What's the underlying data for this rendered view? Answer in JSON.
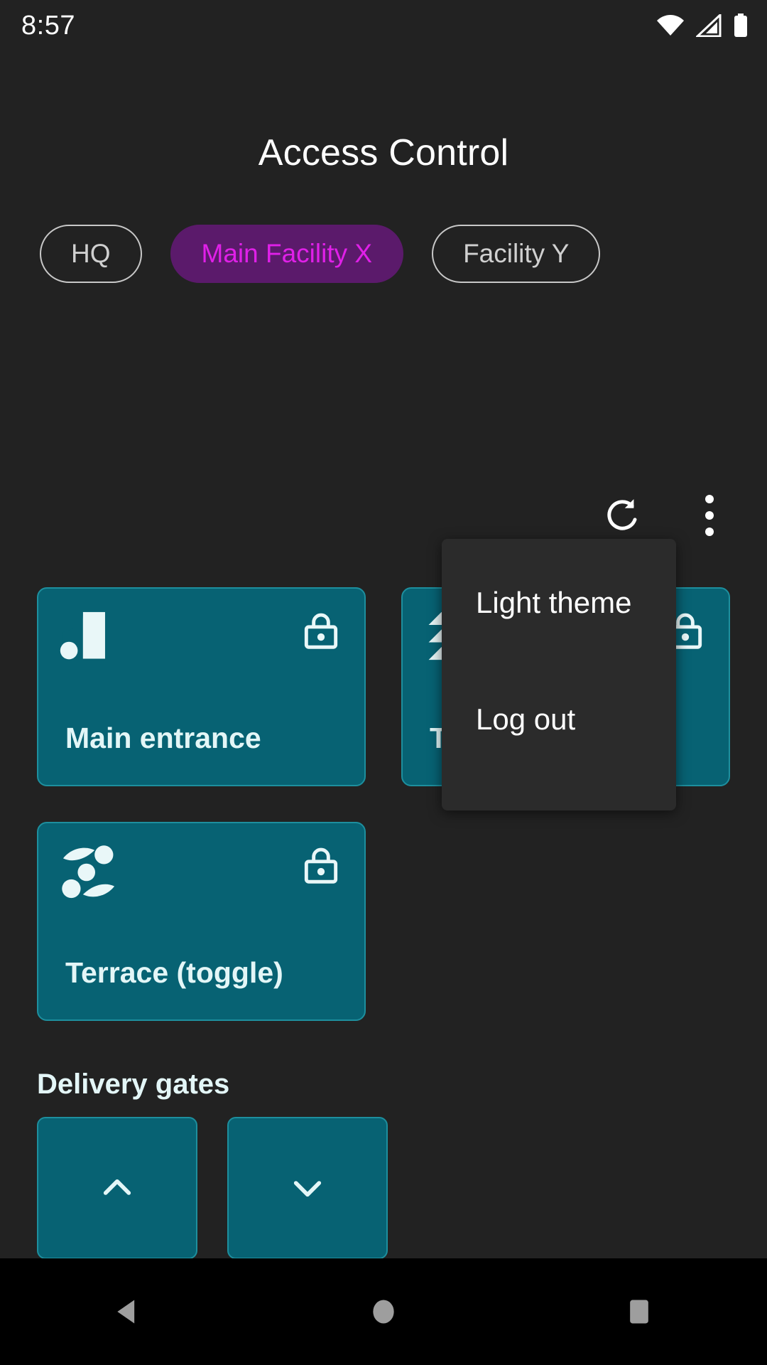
{
  "status_bar": {
    "time": "8:57",
    "icons": [
      "wifi-icon",
      "cellular-signal-icon",
      "battery-icon"
    ]
  },
  "header": {
    "title": "Access Control"
  },
  "facility_chips": [
    {
      "label": "HQ",
      "selected": false
    },
    {
      "label": "Main Facility X",
      "selected": true
    },
    {
      "label": "Facility Y",
      "selected": false
    }
  ],
  "actions": {
    "refresh": "refresh-icon",
    "overflow": "more-vertical-icon"
  },
  "doors": [
    {
      "label": "Main entrance",
      "lock_state": "locked",
      "glyph": "door-glyph-1"
    },
    {
      "label": "T",
      "lock_state": "locked",
      "glyph": "door-glyph-2"
    },
    {
      "label": "Terrace (toggle)",
      "lock_state": "locked",
      "glyph": "door-glyph-3"
    }
  ],
  "delivery_gates": {
    "heading": "Delivery gates",
    "buttons": [
      {
        "icon": "chevron-up-icon"
      },
      {
        "icon": "chevron-down-icon"
      }
    ]
  },
  "overflow_menu": {
    "items": [
      "Light theme",
      "Log out"
    ]
  },
  "nav_bar": {
    "back": "back-triangle-icon",
    "home": "home-circle-icon",
    "recents": "recents-square-icon"
  },
  "colors": {
    "background": "#222222",
    "card_fill": "#076273",
    "card_border": "#1D8F9E",
    "chip_selected_bg": "#5B1A6B",
    "chip_selected_text": "#E020E8",
    "menu_bg": "#2B2B2B",
    "navbar_bg": "#000000",
    "text_primary": "#FFFFFF",
    "card_text": "#E3F6F7"
  }
}
